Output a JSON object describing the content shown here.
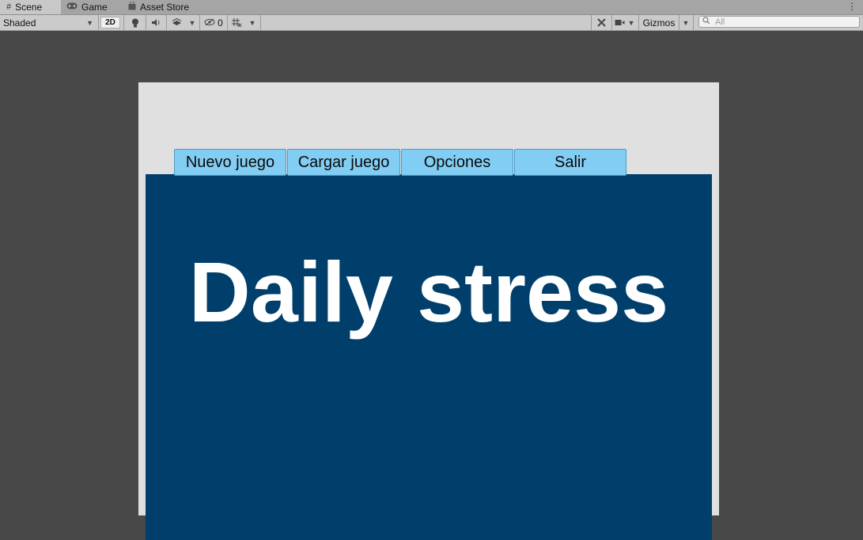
{
  "tabs": [
    {
      "label": "Scene",
      "icon": "grid-icon",
      "active": true
    },
    {
      "label": "Game",
      "icon": "gamepad-icon",
      "active": false
    },
    {
      "label": "Asset Store",
      "icon": "bag-icon",
      "active": false
    }
  ],
  "toolbar": {
    "draw_mode": "Shaded",
    "mode_2d": "2D",
    "hidden_count": "0",
    "gizmos_label": "Gizmos",
    "search_placeholder": "All"
  },
  "menu": {
    "buttons": [
      "Nuevo juego",
      "Cargar juego",
      "Opciones",
      "Salir"
    ]
  },
  "game_title": "Daily stress",
  "colors": {
    "panel": "#003f6c",
    "button": "#82cdf3",
    "canvas_bg": "#e0e0e0",
    "scene_bg": "#484848"
  }
}
